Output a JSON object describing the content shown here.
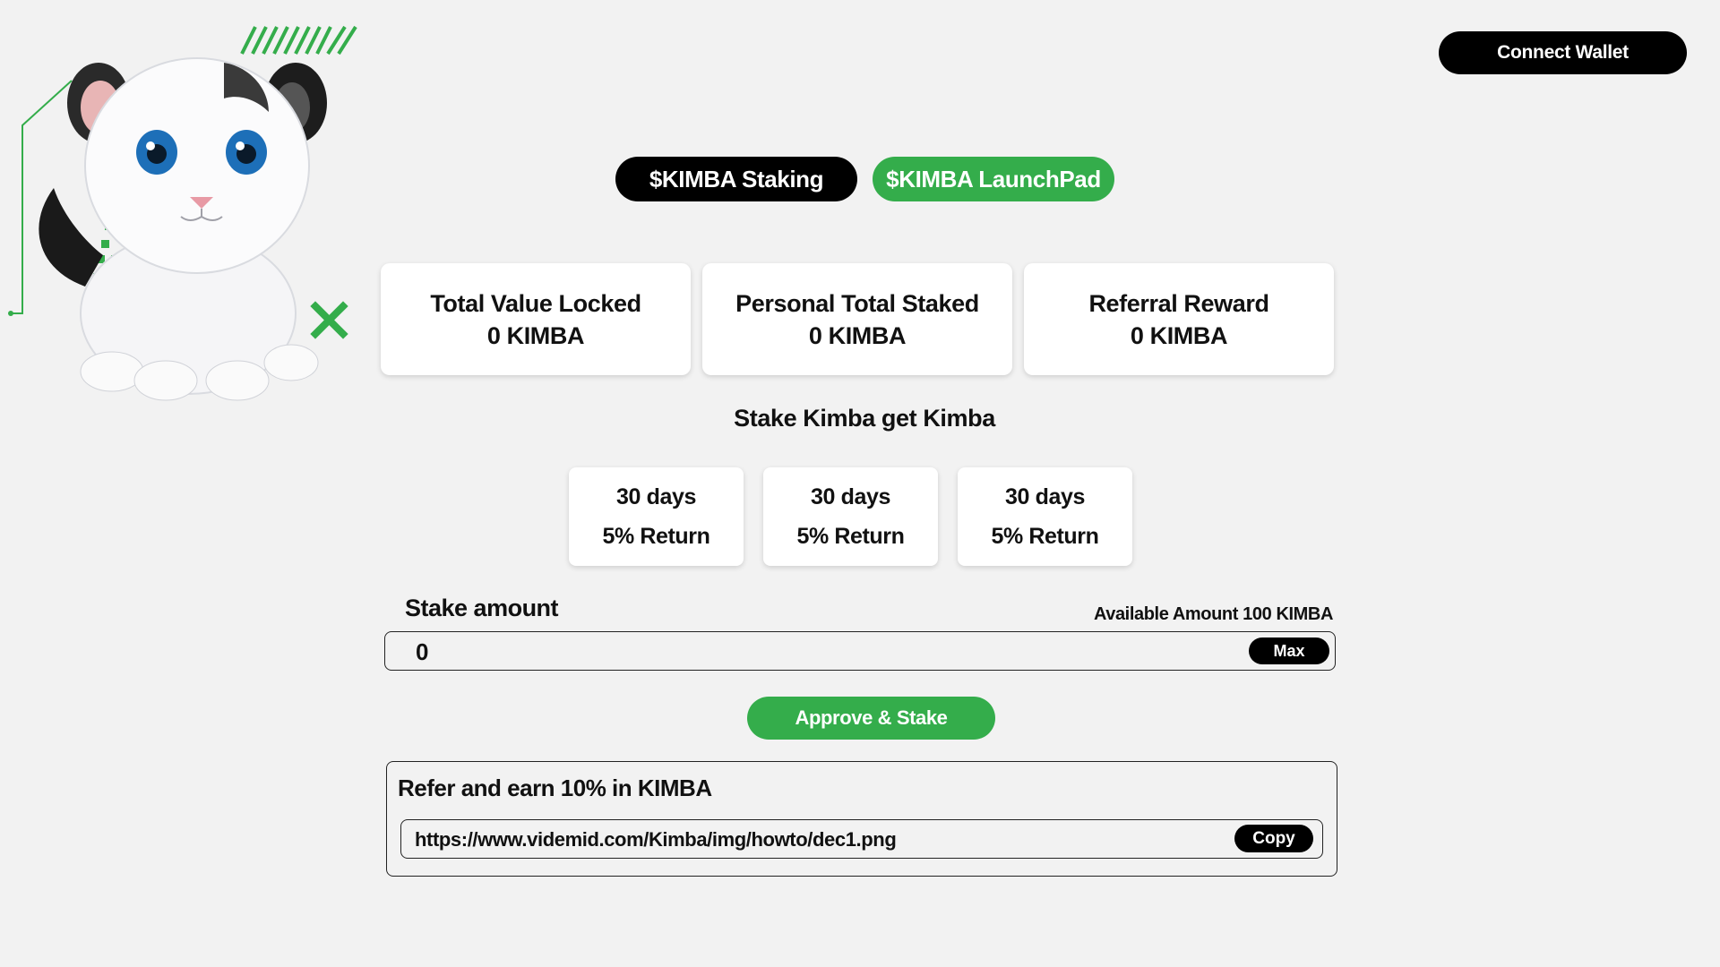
{
  "header": {
    "connect_wallet_label": "Connect Wallet"
  },
  "mascot": {
    "icon": "white-lion-cub-mascot",
    "accent_color": "#34ad4b"
  },
  "tabs": [
    {
      "label": "$KIMBA Staking",
      "active": true
    },
    {
      "label": "$KIMBA LaunchPad",
      "active": false
    }
  ],
  "stats": [
    {
      "title": "Total Value Locked",
      "value": "0 KIMBA"
    },
    {
      "title": "Personal Total Staked",
      "value": "0 KIMBA"
    },
    {
      "title": "Referral Reward",
      "value": "0 KIMBA"
    }
  ],
  "staking": {
    "heading": "Stake Kimba get Kimba",
    "plans": [
      {
        "duration": "30 days",
        "return": "5% Return"
      },
      {
        "duration": "30 days",
        "return": "5% Return"
      },
      {
        "duration": "30 days",
        "return": "5% Return"
      }
    ],
    "amount_label": "Stake amount",
    "available_label": "Available Amount 100 KIMBA",
    "amount_value": "0",
    "max_label": "Max",
    "approve_label": "Approve & Stake"
  },
  "referral": {
    "title": "Refer and earn 10% in KIMBA",
    "link": "https://www.videmid.com/Kimba/img/howto/dec1.png",
    "copy_label": "Copy"
  },
  "colors": {
    "brand_green": "#34ad4b",
    "black": "#000000",
    "background": "#f2f2f2"
  }
}
